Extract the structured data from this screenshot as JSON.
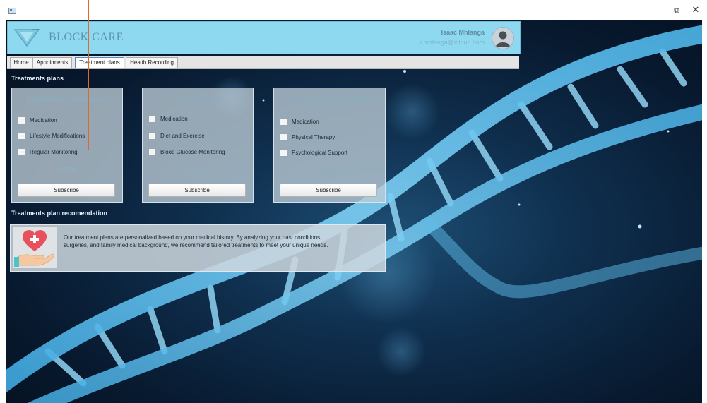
{
  "window": {
    "controls": {
      "minimize": "–",
      "maximize": "⧉",
      "close": "✕"
    }
  },
  "header": {
    "brand": "BLOCK CARE",
    "user_name": "Isaac Mhlanga",
    "user_email": "i.mhlanga@icloud.com",
    "colors": {
      "header_bg": "#8fd9f0",
      "brand_text": "#5c95ad"
    }
  },
  "tabs": [
    {
      "label": "Home",
      "active": false
    },
    {
      "label": "Appoitments",
      "active": false
    },
    {
      "label": "Treatment plans",
      "active": true
    },
    {
      "label": "Health Recording",
      "active": false
    }
  ],
  "plans_section": {
    "title": "Treatments plans",
    "cards": [
      {
        "title": "Hypertension Management",
        "options": [
          "Medication",
          "Lifestyle Modifications",
          "Regular Monitoring"
        ],
        "price": "R2000",
        "button": "Subscribe"
      },
      {
        "title": "Diabetes Care",
        "options": [
          "Medication",
          "Diet and Exercise",
          "Blood Glucose Monitoring"
        ],
        "price": "R4000",
        "button": "Subscribe"
      },
      {
        "title": "Chronic Pain Management",
        "options": [
          "Medication",
          "Physical Therapy",
          "Psychological Support"
        ],
        "price": "R6000",
        "button": "Subscribe"
      }
    ]
  },
  "recommendation": {
    "title": "Treatments plan recomendation",
    "icon": "heart-hand-icon",
    "text": "Our treatment plans are personalized based on your medical history. By analyzing your past conditions, surgeries, and family medical background, we recommend tailored treatments to meet your unique needs."
  }
}
